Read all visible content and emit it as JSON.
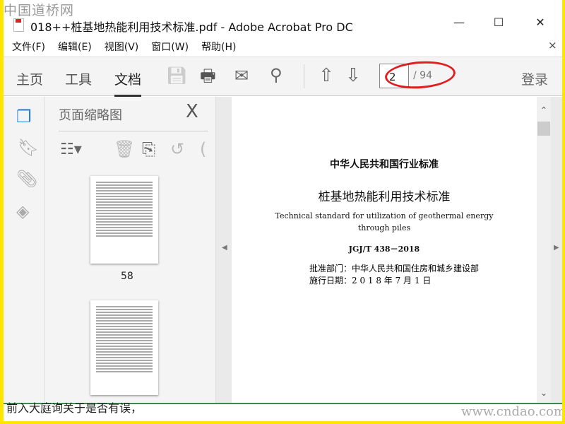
{
  "watermark_top": "中国道桥网",
  "window": {
    "title": "018++桩基地热能利用技术标准.pdf - Adobe Acrobat Pro DC",
    "minimize": "—",
    "maximize": "☐",
    "close": "✕"
  },
  "menu": {
    "items": [
      "文件(F)",
      "编辑(E)",
      "视图(V)",
      "窗口(W)",
      "帮助(H)"
    ],
    "close": "×"
  },
  "toolbar": {
    "tabs": [
      "主页",
      "工具",
      "文档"
    ],
    "active_tab": "文档",
    "page_current": "2",
    "page_total": "/ 94",
    "login": "登录",
    "highlight_color": "#e02020"
  },
  "panel": {
    "title": "页面缩略图",
    "close": "X",
    "thumbnails": [
      {
        "label": "58"
      },
      {
        "label": ""
      }
    ]
  },
  "document": {
    "line1": "中华人民共和国行业标准",
    "line2": "桩基地热能利用技术标准",
    "line3": "Technical standard for utilization of geothermal energy",
    "line4": "through piles",
    "code": "JGJ/T 438－2018",
    "dept": "批准部门：中华人民共和国住房和城乡建设部",
    "date": "施行日期：2 0 1 8 年 7 月 1 日"
  },
  "bottom": {
    "cut_text": "前入大庭询关于是否有误，",
    "watermark": "www.cndao.com"
  }
}
